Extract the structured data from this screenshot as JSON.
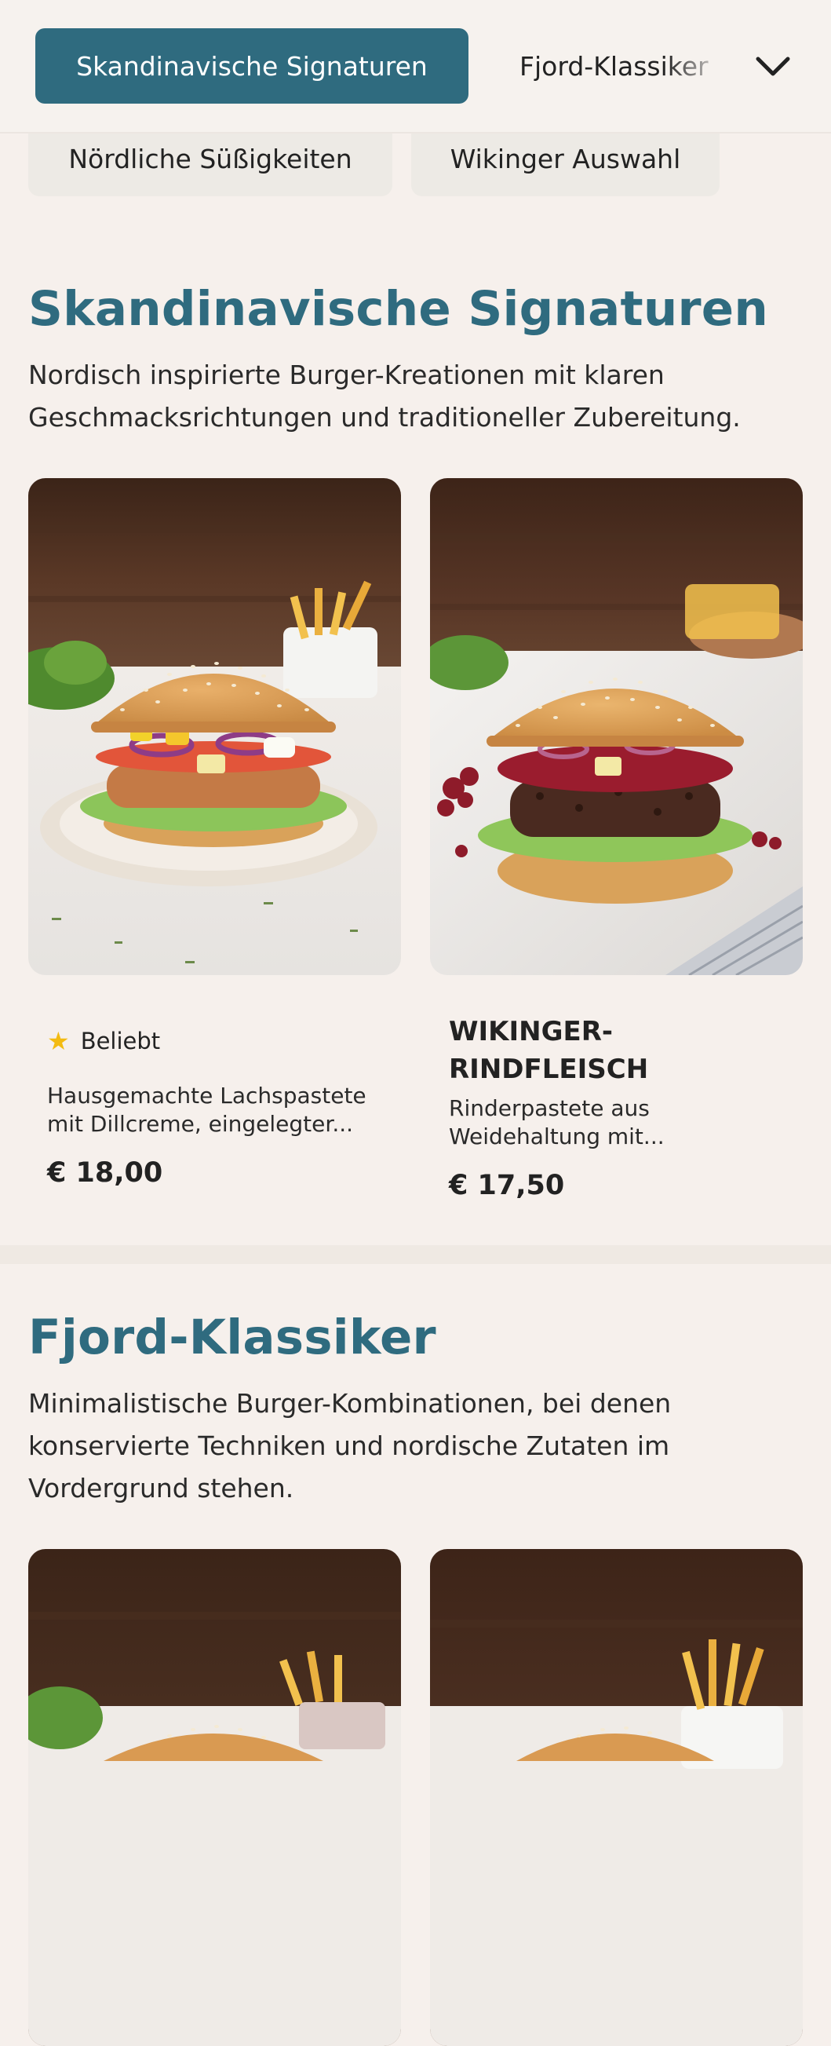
{
  "nav": {
    "active_tab": "Skandinavische Signaturen",
    "tabs": [
      "Skandinavische Signaturen",
      "Fjord-Klassiker",
      "Nördliche Süßigkeiten",
      "Wikinger Auswahl"
    ],
    "expand_icon": "chevron-down-icon"
  },
  "sections": [
    {
      "title": "Skandinavische Signaturen",
      "description": "Nordisch inspirierte Burger-Kreationen mit klaren Geschmacksrichtungen und traditioneller Zubereitung.",
      "items": [
        {
          "badge": "Beliebt",
          "badge_icon": "star-icon",
          "name": "",
          "description": "Hausgemachte Lachspastete mit Dillcreme, eingelegter...",
          "price": "€ 18,00"
        },
        {
          "badge": "",
          "name": "WIKINGER-RINDFLEISCH",
          "description": "Rinderpastete aus Weidehaltung mit...",
          "price": "€ 17,50"
        }
      ]
    },
    {
      "title": "Fjord-Klassiker",
      "description": "Minimalistische Burger-Kombinationen, bei denen konservierte Techniken und nordische Zutaten im Vordergrund stehen.",
      "items": []
    }
  ],
  "colors": {
    "accent": "#2f6b7f",
    "background": "#f6f0ec",
    "star": "#f3bb12"
  }
}
